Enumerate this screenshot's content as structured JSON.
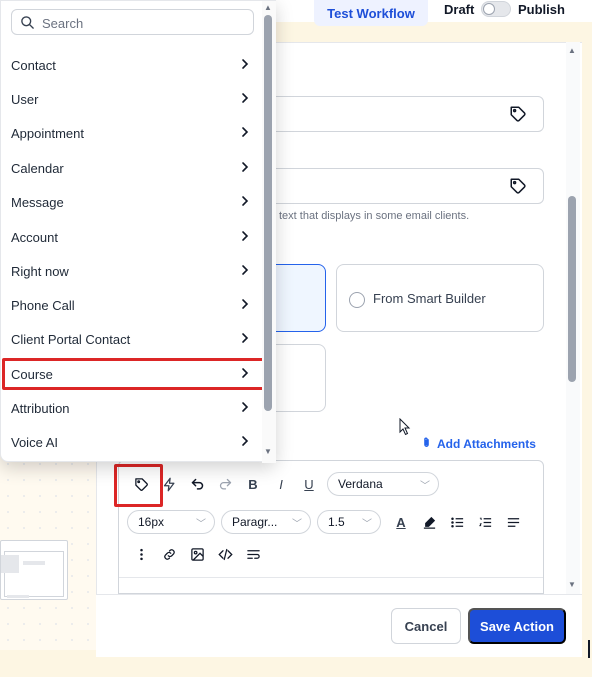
{
  "header": {
    "test_workflow_label": "Test Workflow",
    "draft_label": "Draft",
    "publish_label": "Publish"
  },
  "menu": {
    "search_placeholder": "Search",
    "items": [
      {
        "label": "Contact"
      },
      {
        "label": "User"
      },
      {
        "label": "Appointment"
      },
      {
        "label": "Calendar"
      },
      {
        "label": "Message"
      },
      {
        "label": "Account"
      },
      {
        "label": "Right now"
      },
      {
        "label": "Phone Call"
      },
      {
        "label": "Client Portal Contact"
      },
      {
        "label": "Course"
      },
      {
        "label": "Attribution"
      },
      {
        "label": "Voice AI"
      }
    ],
    "highlighted_item": "Course"
  },
  "panel": {
    "paren_fragment": ")",
    "preview_help_text": "w text that displays in some email clients.",
    "template_option_label": "From Smart Builder",
    "add_attachments_label": "Add Attachments",
    "editor": {
      "font_family": "Verdana",
      "font_size": "16px",
      "paragraph": "Paragr...",
      "line_height": "1.5",
      "bold": "B",
      "italic": "I",
      "underline": "U",
      "text_color": "A"
    },
    "cancel_label": "Cancel",
    "save_label": "Save Action"
  },
  "colors": {
    "accent": "#1d4ed8",
    "highlight_box": "#dc2626",
    "background": "#fdf6e3"
  }
}
